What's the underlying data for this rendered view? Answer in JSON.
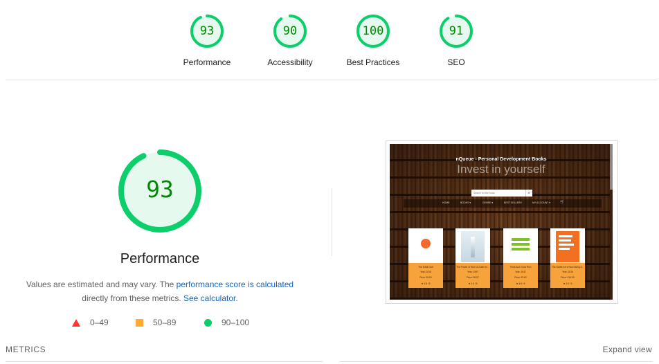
{
  "categories": [
    {
      "score": "93",
      "label": "Performance",
      "fraction": 0.93
    },
    {
      "score": "90",
      "label": "Accessibility",
      "fraction": 0.9
    },
    {
      "score": "100",
      "label": "Best Practices",
      "fraction": 1.0
    },
    {
      "score": "91",
      "label": "SEO",
      "fraction": 0.91
    }
  ],
  "performance": {
    "score": "93",
    "fraction": 0.93,
    "title": "Performance",
    "desc_prefix": "Values are estimated and may vary. The ",
    "desc_link1": "performance score is calculated",
    "desc_middle": " directly from these metrics. ",
    "desc_link2": "See calculator",
    "desc_suffix": "."
  },
  "legend": {
    "fail": "0–49",
    "average": "50–89",
    "pass": "90–100"
  },
  "colors": {
    "pass": "#0cce6b",
    "pass_text": "#008800",
    "pass_bg": "#e6f9ef",
    "average": "#ffaa33",
    "fail": "#ff3333",
    "link": "#1565c0"
  },
  "screenshot": {
    "site_title": "nQueue - Personal Development Books",
    "tagline": "Invest in yourself",
    "search_placeholder": "Search for the book",
    "search_icon": "search-icon",
    "nav": [
      "HOME",
      "BOOKS ▾",
      "GENRE ▾",
      "BEST SELLERS",
      "MY ACCOUNT ▾"
    ],
    "books": [
      {
        "title": "The 5 AM Club",
        "year": "Year: 2018",
        "price": "Price: £5.00",
        "rating": "★ 4.8 / 5"
      },
      {
        "title": "The Power of Now: A Guide to...",
        "year": "Year: 1997",
        "price": "Price: £8.97",
        "rating": "★ 4.6 / 5"
      },
      {
        "title": "Think And Grow Rich",
        "year": "Year: 1937",
        "price": "Price: £3.62",
        "rating": "★ 4.6 / 5"
      },
      {
        "title": "The Subtle Art of Not Giving a...",
        "year": "Year: 2016",
        "price": "Price: £14.59",
        "rating": "★ 4.5 / 5"
      }
    ]
  },
  "metrics": {
    "header": "METRICS",
    "expand": "Expand view"
  }
}
